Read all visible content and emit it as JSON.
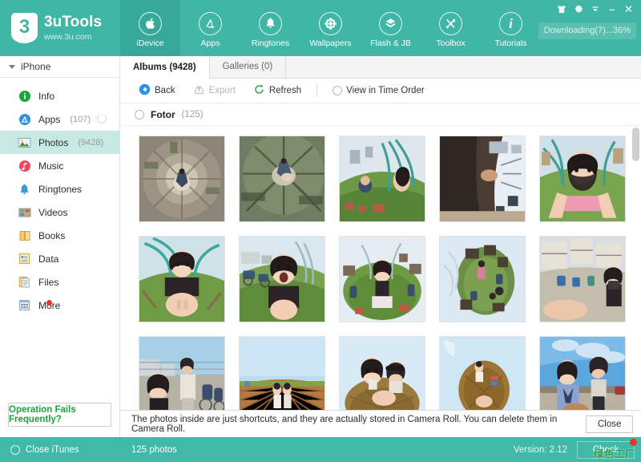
{
  "brand": {
    "logo_text": "3",
    "name": "3uTools",
    "url": "www.3u.com"
  },
  "nav": {
    "tabs": [
      {
        "label": "iDevice",
        "icon": "apple-icon",
        "active": true
      },
      {
        "label": "Apps",
        "icon": "appstore-icon",
        "active": false
      },
      {
        "label": "Ringtones",
        "icon": "bell-icon",
        "active": false
      },
      {
        "label": "Wallpapers",
        "icon": "flower-icon",
        "active": false
      },
      {
        "label": "Flash & JB",
        "icon": "box-open-icon",
        "active": false
      },
      {
        "label": "Toolbox",
        "icon": "tools-icon",
        "active": false
      },
      {
        "label": "Tutorials",
        "icon": "info-icon",
        "active": false
      }
    ]
  },
  "window_controls": [
    {
      "name": "skin-icon",
      "glyph": "tshirt"
    },
    {
      "name": "settings-icon",
      "glyph": "gear"
    },
    {
      "name": "menu-icon",
      "glyph": "menu-down"
    },
    {
      "name": "minimize-icon",
      "glyph": "minimize"
    },
    {
      "name": "close-icon",
      "glyph": "close"
    }
  ],
  "download_status": "Downloading(7)...36%",
  "sidebar": {
    "device": "iPhone",
    "items": [
      {
        "label": "Info",
        "count": "",
        "icon": "info-circle-icon",
        "active": false,
        "loading": false,
        "badge": false
      },
      {
        "label": "Apps",
        "count": "(107)",
        "icon": "appstore-circle-icon",
        "active": false,
        "loading": true,
        "badge": false
      },
      {
        "label": "Photos",
        "count": "(9428)",
        "icon": "photo-icon",
        "active": true,
        "loading": false,
        "badge": false
      },
      {
        "label": "Music",
        "count": "",
        "icon": "music-circle-icon",
        "active": false,
        "loading": false,
        "badge": false
      },
      {
        "label": "Ringtones",
        "count": "",
        "icon": "bell-icon",
        "active": false,
        "loading": false,
        "badge": false
      },
      {
        "label": "Videos",
        "count": "",
        "icon": "film-icon",
        "active": false,
        "loading": false,
        "badge": false
      },
      {
        "label": "Books",
        "count": "",
        "icon": "book-icon",
        "active": false,
        "loading": false,
        "badge": false
      },
      {
        "label": "Data",
        "count": "",
        "icon": "data-doc-icon",
        "active": false,
        "loading": false,
        "badge": false
      },
      {
        "label": "Files",
        "count": "",
        "icon": "files-icon",
        "active": false,
        "loading": false,
        "badge": false
      },
      {
        "label": "More",
        "count": "",
        "icon": "grid-more-icon",
        "active": false,
        "loading": false,
        "badge": true
      }
    ],
    "ops_button": "Operation Fails Frequently?"
  },
  "content": {
    "tabs": [
      {
        "label": "Albums (9428)",
        "active": true
      },
      {
        "label": "Galleries (0)",
        "active": false
      }
    ],
    "actions": [
      {
        "label": "Back",
        "icon": "back-arrow-icon",
        "disabled": false
      },
      {
        "label": "Export",
        "icon": "export-icon",
        "disabled": true
      },
      {
        "label": "Refresh",
        "icon": "refresh-icon",
        "disabled": false
      }
    ],
    "view_option": {
      "label": "View in Time Order",
      "checked": false
    },
    "album": {
      "name": "Fotor",
      "count": "(125)",
      "checked": false
    },
    "photos": [
      {
        "alt": "tiny-planet-brick-courtyard"
      },
      {
        "alt": "tiny-planet-bamboo-street"
      },
      {
        "alt": "tiny-planet-girl-grass-tent"
      },
      {
        "alt": "tiny-planet-dark-sleeve-sky"
      },
      {
        "alt": "selfie-girl-pink-dress-grass"
      },
      {
        "alt": "tiny-planet-girl-teal-hoops"
      },
      {
        "alt": "girl-shouting-scooters-street"
      },
      {
        "alt": "girl-sitting-green-planet"
      },
      {
        "alt": "tiny-planet-market-crowd"
      },
      {
        "alt": "girl-camera-courtyard"
      },
      {
        "alt": "girl-man-walking-street"
      },
      {
        "alt": "two-girls-field-horizon"
      },
      {
        "alt": "two-girls-selfie-hill"
      },
      {
        "alt": "tiny-planet-brown-hill-couple"
      },
      {
        "alt": "two-girls-blue-sky-road"
      }
    ]
  },
  "notice": {
    "text": "The photos inside are just shortcuts, and they are actually stored in Camera Roll. You can delete them in Camera Roll.",
    "close_label": "Close"
  },
  "status": {
    "close_itunes": "Close iTunes",
    "photo_count": "125 photos",
    "version": "Version: 2.12",
    "check_label": "Check",
    "watermark": "绿色工厂"
  },
  "colors": {
    "teal": "#41b8a8",
    "teal_active": "#37a99a",
    "sidebar_active": "#c8e9e3",
    "green_text": "#17a538",
    "red_badge": "#e8322a"
  }
}
